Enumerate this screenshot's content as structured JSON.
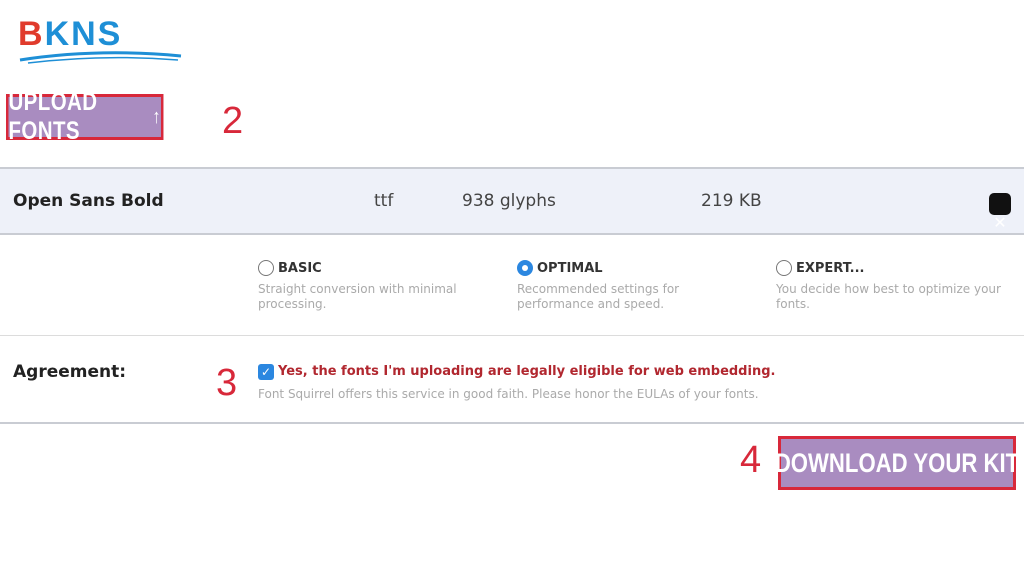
{
  "logo": {
    "text_first": "B",
    "text_rest": "KNS"
  },
  "upload": {
    "label": "UPLOAD FONTS",
    "icon": "up-arrow-icon",
    "arrow": "↑"
  },
  "steps": [
    "2",
    "3",
    "4"
  ],
  "file": {
    "name": "Open Sans Bold",
    "type": "ttf",
    "glyphs": "938 glyphs",
    "size": "219 KB",
    "close_glyph": "✕"
  },
  "modes": [
    {
      "label": "BASIC",
      "desc": "Straight conversion with minimal processing.",
      "selected": false
    },
    {
      "label": "OPTIMAL",
      "desc": "Recommended settings for performance and speed.",
      "selected": true
    },
    {
      "label": "EXPERT...",
      "desc": "You decide how best to optimize your fonts.",
      "selected": false
    }
  ],
  "agreement": {
    "label": "Agreement:",
    "checked": true,
    "check_glyph": "✓",
    "text": "Yes, the fonts I'm uploading are legally eligible for web embedding.",
    "note": "Font Squirrel offers this service in good faith. Please honor the EULAs of your fonts."
  },
  "download": {
    "label": "DOWNLOAD YOUR KIT"
  },
  "colors": {
    "accent_purple": "#a98cc0",
    "highlight_red": "#d8283a",
    "radio_blue": "#2b87e0",
    "warning_red": "#b1272f"
  }
}
